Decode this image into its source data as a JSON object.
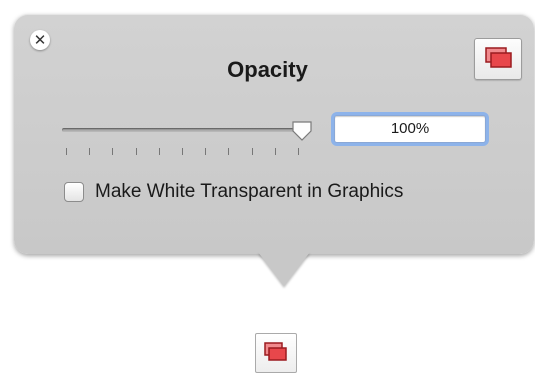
{
  "popover": {
    "title": "Opacity",
    "close_icon": "close-icon",
    "detach_icon": "stacked-windows-icon"
  },
  "opacity": {
    "value_text": "100%",
    "value_fraction": 1.0,
    "tick_count": 11
  },
  "options": {
    "make_white_transparent_label": "Make White Transparent in Graphics",
    "make_white_transparent_checked": false
  },
  "toolbar": {
    "opacity_icon": "stacked-windows-icon"
  },
  "colors": {
    "panel": "#c8c8c8",
    "icon_fill": "#e8474b",
    "icon_stroke": "#9b1b1f",
    "focus_ring": "#8db3ea"
  }
}
